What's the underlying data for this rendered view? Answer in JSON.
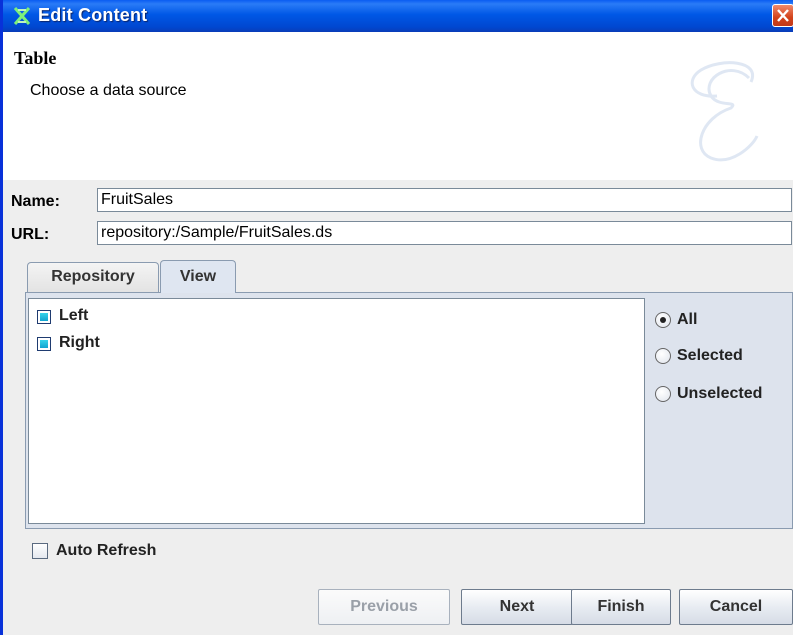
{
  "window": {
    "title": "Edit Content",
    "colors": {
      "titlebar": "#0058e6",
      "close": "#d2421a",
      "panel": "#dde3ed"
    }
  },
  "header": {
    "title": "Table",
    "subtitle": "Choose a data source",
    "logo_icon": "script-e-logo"
  },
  "fields": {
    "name_label": "Name:",
    "name_value": "FruitSales",
    "url_label": "URL:",
    "url_value": "repository:/Sample/FruitSales.ds"
  },
  "tabs": [
    {
      "label": "Repository",
      "selected": false
    },
    {
      "label": "View",
      "selected": true
    }
  ],
  "tree": {
    "items": [
      {
        "label": "Left"
      },
      {
        "label": "Right"
      }
    ]
  },
  "filter": {
    "options": [
      {
        "label": "All",
        "selected": true
      },
      {
        "label": "Selected",
        "selected": false
      },
      {
        "label": "Unselected",
        "selected": false
      }
    ]
  },
  "auto_refresh": {
    "label": "Auto Refresh",
    "checked": false
  },
  "buttons": {
    "previous": "Previous",
    "next": "Next",
    "finish": "Finish",
    "cancel": "Cancel"
  }
}
